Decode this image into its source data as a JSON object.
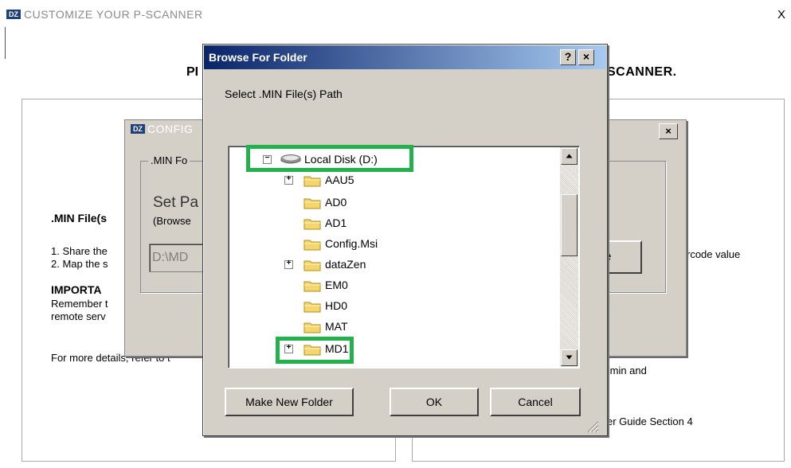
{
  "main_window": {
    "logo": "DZ",
    "title": "CUSTOMIZE YOUR P-SCANNER",
    "close": "X",
    "heading_left": "PI",
    "heading_right": "SCANNER.",
    "left_panel": {
      "section_label": ".MIN File(s",
      "instructions": [
        "1. Share the",
        "2. Map the s"
      ],
      "important_label": "IMPORTA",
      "remember_text": "Remember t",
      "remote_text": "remote serv",
      "more_details": "For more details, refer to t"
    },
    "right_panel": {
      "barcode_text": "rcode value",
      "min_and_text": ".min and",
      "guide_text": "er Guide Section 4"
    }
  },
  "config_dialog": {
    "logo": "DZ",
    "title": "CONFIG",
    "close": "×",
    "group_label": ".MIN Fo",
    "set_path_label": "Set Pa",
    "browse_hint": "(Browse",
    "path_value": "D:\\MD",
    "browse_button": "e"
  },
  "browse_dialog": {
    "title": "Browse For Folder",
    "help_button": "?",
    "close_button": "×",
    "prompt": "Select .MIN File(s) Path",
    "tree": {
      "root": {
        "label": "Local Disk (D:)",
        "expander": "−",
        "icon": "drive-icon"
      },
      "children": [
        {
          "label": "AAU5",
          "expander": "+",
          "icon": "folder-icon"
        },
        {
          "label": "AD0",
          "expander": "",
          "icon": "folder-icon"
        },
        {
          "label": "AD1",
          "expander": "",
          "icon": "folder-icon"
        },
        {
          "label": "Config.Msi",
          "expander": "",
          "icon": "folder-icon"
        },
        {
          "label": "dataZen",
          "expander": "+",
          "icon": "folder-icon"
        },
        {
          "label": "EM0",
          "expander": "",
          "icon": "folder-icon"
        },
        {
          "label": "HD0",
          "expander": "",
          "icon": "folder-icon"
        },
        {
          "label": "MAT",
          "expander": "",
          "icon": "folder-icon"
        },
        {
          "label": "MD1",
          "expander": "+",
          "icon": "folder-icon"
        }
      ]
    },
    "buttons": {
      "make_new_folder": "Make New Folder",
      "ok": "OK",
      "cancel": "Cancel"
    },
    "highlight_color": "#22b14c",
    "titlebar_gradient": [
      "#0a246a",
      "#a6caf0"
    ]
  }
}
